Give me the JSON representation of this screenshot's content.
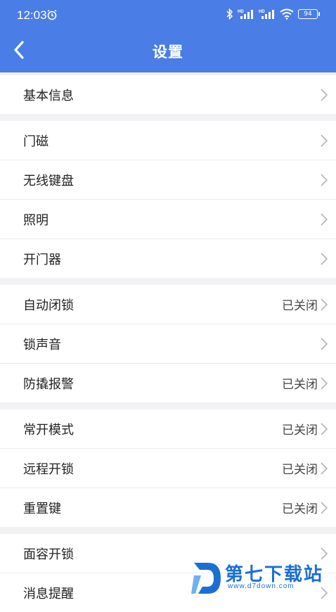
{
  "status_bar": {
    "time": "12:03",
    "battery": "94",
    "network_badge_1": "HD",
    "network_badge_2": "HD"
  },
  "header": {
    "title": "设置"
  },
  "groups": [
    {
      "items": [
        {
          "label": "基本信息",
          "value": ""
        }
      ]
    },
    {
      "items": [
        {
          "label": "门磁",
          "value": ""
        },
        {
          "label": "无线键盘",
          "value": ""
        },
        {
          "label": "照明",
          "value": ""
        },
        {
          "label": "开门器",
          "value": ""
        }
      ]
    },
    {
      "items": [
        {
          "label": "自动闭锁",
          "value": "已关闭"
        },
        {
          "label": "锁声音",
          "value": ""
        },
        {
          "label": "防撬报警",
          "value": "已关闭"
        }
      ]
    },
    {
      "items": [
        {
          "label": "常开模式",
          "value": "已关闭"
        },
        {
          "label": "远程开锁",
          "value": "已关闭"
        },
        {
          "label": "重置键",
          "value": "已关闭"
        }
      ]
    },
    {
      "items": [
        {
          "label": "面容开锁",
          "value": ""
        },
        {
          "label": "消息提醒",
          "value": ""
        }
      ]
    }
  ],
  "watermark": {
    "text": "第七下载站",
    "url": "www.d7down.com"
  },
  "colors": {
    "header_bg": "#4a7ee6",
    "page_bg": "#f2f2f4",
    "watermark": "#1b6fd2"
  }
}
